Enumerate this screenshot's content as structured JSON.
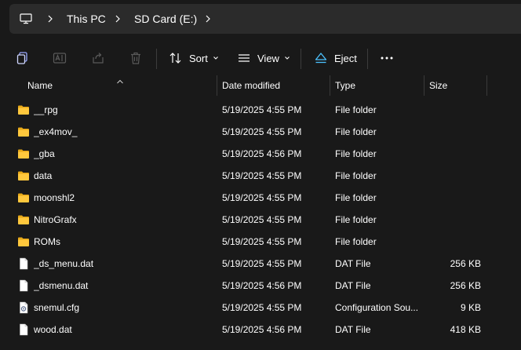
{
  "addressbar": {
    "computer_icon": "computer-icon",
    "crumbs": [
      "This PC",
      "SD Card (E:)"
    ]
  },
  "toolbar": {
    "sort_label": "Sort",
    "view_label": "View",
    "eject_label": "Eject",
    "accent": "#4cc2ff"
  },
  "columns": {
    "name": "Name",
    "date": "Date modified",
    "type": "Type",
    "size": "Size"
  },
  "files": [
    {
      "name": "__rpg",
      "date": "5/19/2025 4:55 PM",
      "type": "File folder",
      "size": "",
      "icon": "folder-icon"
    },
    {
      "name": "_ex4mov_",
      "date": "5/19/2025 4:55 PM",
      "type": "File folder",
      "size": "",
      "icon": "folder-icon"
    },
    {
      "name": "_gba",
      "date": "5/19/2025 4:56 PM",
      "type": "File folder",
      "size": "",
      "icon": "folder-icon"
    },
    {
      "name": "data",
      "date": "5/19/2025 4:55 PM",
      "type": "File folder",
      "size": "",
      "icon": "folder-icon"
    },
    {
      "name": "moonshl2",
      "date": "5/19/2025 4:55 PM",
      "type": "File folder",
      "size": "",
      "icon": "folder-icon"
    },
    {
      "name": "NitroGrafx",
      "date": "5/19/2025 4:55 PM",
      "type": "File folder",
      "size": "",
      "icon": "folder-icon"
    },
    {
      "name": "ROMs",
      "date": "5/19/2025 4:55 PM",
      "type": "File folder",
      "size": "",
      "icon": "folder-icon"
    },
    {
      "name": "_ds_menu.dat",
      "date": "5/19/2025 4:55 PM",
      "type": "DAT File",
      "size": "256 KB",
      "icon": "file-icon"
    },
    {
      "name": "_dsmenu.dat",
      "date": "5/19/2025 4:56 PM",
      "type": "DAT File",
      "size": "256 KB",
      "icon": "file-icon"
    },
    {
      "name": "snemul.cfg",
      "date": "5/19/2025 4:55 PM",
      "type": "Configuration Sou...",
      "size": "9 KB",
      "icon": "config-file-icon"
    },
    {
      "name": "wood.dat",
      "date": "5/19/2025 4:56 PM",
      "type": "DAT File",
      "size": "418 KB",
      "icon": "file-icon"
    }
  ]
}
